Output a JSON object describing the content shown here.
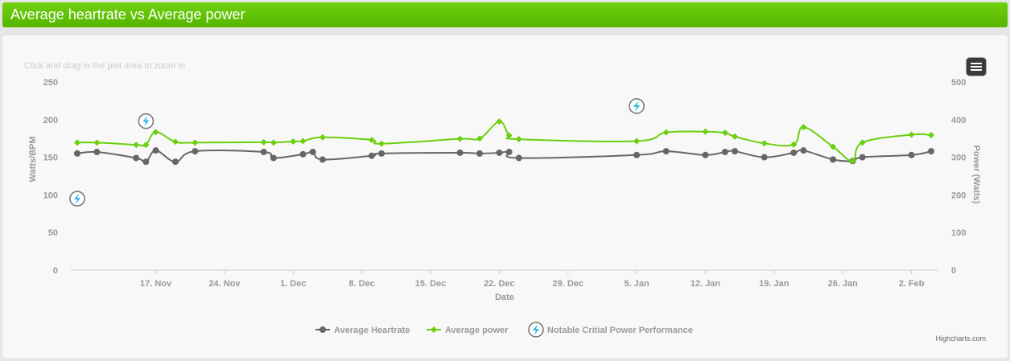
{
  "page": {
    "title": "Average heartrate vs Average power",
    "zoom_hint": "Click and drag in the plot area to zoom in",
    "credits": "Highcharts.com"
  },
  "colors": {
    "header": "#5cc000",
    "heartrate": "#666666",
    "power": "#6bd00d",
    "lightning": "#2ab8e8"
  },
  "chart_data": {
    "type": "line",
    "xlabel": "Date",
    "ylabel_left": "Watts/BPM",
    "ylabel_right": "Power (Watts)",
    "x_range": [
      "2013-11-09",
      "2014-02-04"
    ],
    "ylim_left": [
      0,
      250
    ],
    "ylim_right": [
      0,
      500
    ],
    "y_ticks_left": [
      0,
      50,
      100,
      150,
      200,
      250
    ],
    "y_ticks_right": [
      0,
      100,
      200,
      300,
      400,
      500
    ],
    "x_ticks": [
      {
        "date": "2013-11-17",
        "label": "17. Nov"
      },
      {
        "date": "2013-11-24",
        "label": "24. Nov"
      },
      {
        "date": "2013-12-01",
        "label": "1. Dec"
      },
      {
        "date": "2013-12-08",
        "label": "8. Dec"
      },
      {
        "date": "2013-12-15",
        "label": "15. Dec"
      },
      {
        "date": "2013-12-22",
        "label": "22. Dec"
      },
      {
        "date": "2013-12-29",
        "label": "29. Dec"
      },
      {
        "date": "2014-01-05",
        "label": "5. Jan"
      },
      {
        "date": "2014-01-12",
        "label": "12. Jan"
      },
      {
        "date": "2014-01-19",
        "label": "19. Jan"
      },
      {
        "date": "2014-01-26",
        "label": "26. Jan"
      },
      {
        "date": "2014-02-02",
        "label": "2. Feb"
      }
    ],
    "series": [
      {
        "name": "Average Heartrate",
        "axis": "left",
        "marker": "circle",
        "points": [
          [
            "2013-11-09",
            155
          ],
          [
            "2013-11-11",
            157
          ],
          [
            "2013-11-15",
            149
          ],
          [
            "2013-11-16",
            144
          ],
          [
            "2013-11-17",
            159
          ],
          [
            "2013-11-19",
            144
          ],
          [
            "2013-11-21",
            158
          ],
          [
            "2013-11-28",
            157
          ],
          [
            "2013-11-29",
            149
          ],
          [
            "2013-12-02",
            154
          ],
          [
            "2013-12-03",
            157
          ],
          [
            "2013-12-04",
            147
          ],
          [
            "2013-12-09",
            152
          ],
          [
            "2013-12-10",
            155
          ],
          [
            "2013-12-18",
            156
          ],
          [
            "2013-12-20",
            155
          ],
          [
            "2013-12-22",
            156
          ],
          [
            "2013-12-23",
            157
          ],
          [
            "2013-12-24",
            149
          ],
          [
            "2014-01-05",
            153
          ],
          [
            "2014-01-08",
            158
          ],
          [
            "2014-01-12",
            153
          ],
          [
            "2014-01-14",
            157
          ],
          [
            "2014-01-15",
            158
          ],
          [
            "2014-01-18",
            150
          ],
          [
            "2014-01-21",
            156
          ],
          [
            "2014-01-22",
            159
          ],
          [
            "2014-01-25",
            147
          ],
          [
            "2014-01-27",
            145
          ],
          [
            "2014-01-28",
            150
          ],
          [
            "2014-02-02",
            153
          ],
          [
            "2014-02-04",
            158
          ]
        ]
      },
      {
        "name": "Average power",
        "axis": "right",
        "marker": "diamond",
        "points": [
          [
            "2013-11-09",
            339
          ],
          [
            "2013-11-11",
            339
          ],
          [
            "2013-11-15",
            333
          ],
          [
            "2013-11-16",
            333
          ],
          [
            "2013-11-17",
            367
          ],
          [
            "2013-11-19",
            341
          ],
          [
            "2013-11-21",
            339
          ],
          [
            "2013-11-28",
            340
          ],
          [
            "2013-11-29",
            339
          ],
          [
            "2013-12-01",
            342
          ],
          [
            "2013-12-02",
            343
          ],
          [
            "2013-12-04",
            353
          ],
          [
            "2013-12-09",
            346
          ],
          [
            "2013-12-10",
            336
          ],
          [
            "2013-12-18",
            349
          ],
          [
            "2013-12-20",
            350
          ],
          [
            "2013-12-22",
            395
          ],
          [
            "2013-12-23",
            358
          ],
          [
            "2013-12-24",
            348
          ],
          [
            "2014-01-05",
            343
          ],
          [
            "2014-01-08",
            366
          ],
          [
            "2014-01-12",
            368
          ],
          [
            "2014-01-14",
            365
          ],
          [
            "2014-01-15",
            355
          ],
          [
            "2014-01-18",
            337
          ],
          [
            "2014-01-21",
            334
          ],
          [
            "2014-01-22",
            380
          ],
          [
            "2014-01-25",
            328
          ],
          [
            "2014-01-27",
            290
          ],
          [
            "2014-01-28",
            339
          ],
          [
            "2014-02-02",
            360
          ],
          [
            "2014-02-04",
            359
          ]
        ]
      },
      {
        "name": "Notable Critial Power Performance",
        "axis": "left",
        "marker": "lightning",
        "points": [
          [
            "2013-11-09",
            95
          ],
          [
            "2013-11-16",
            198
          ],
          [
            "2014-01-05",
            218
          ]
        ]
      }
    ],
    "legend_position": "bottom-center",
    "grid": false
  }
}
